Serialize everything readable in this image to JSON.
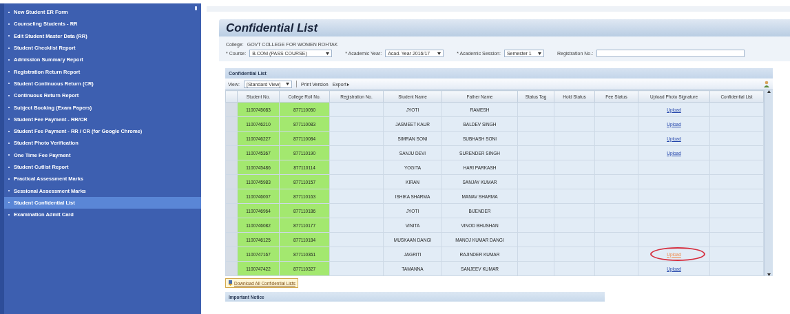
{
  "sidebar": {
    "items": [
      {
        "label": "New Student ER Form",
        "selected": false
      },
      {
        "label": "Counseling Students - RR",
        "selected": false
      },
      {
        "label": "Edit Student Master Data (RR)",
        "selected": false
      },
      {
        "label": "Student Checklist Report",
        "selected": false
      },
      {
        "label": "Admission Summary Report",
        "selected": false
      },
      {
        "label": "Registration Return Report",
        "selected": false
      },
      {
        "label": "Student Continuous Return (CR)",
        "selected": false
      },
      {
        "label": "Continuous Return Report",
        "selected": false
      },
      {
        "label": "Subject Booking (Exam Papers)",
        "selected": false
      },
      {
        "label": "Student Fee Payment - RR/CR",
        "selected": false
      },
      {
        "label": "Student Fee Payment - RR / CR (for Google Chrome)",
        "selected": false
      },
      {
        "label": "Student Photo Verification",
        "selected": false
      },
      {
        "label": "One Time Fee Payment",
        "selected": false
      },
      {
        "label": "Student Cutlist Report",
        "selected": false
      },
      {
        "label": "Practical Assessment Marks",
        "selected": false
      },
      {
        "label": "Sessional Assessment Marks",
        "selected": false
      },
      {
        "label": "Student Confidential List",
        "selected": true
      },
      {
        "label": "Examination Admit Card",
        "selected": false
      }
    ]
  },
  "page": {
    "title": "Confidential List",
    "filters": {
      "college_label": "College:",
      "college": "GOVT COLLEGE FOR WOMEN ROHTAK",
      "fields": [
        {
          "label": "* Course:",
          "value": "B.COM (PASS COURSE)",
          "kind": "dropdown"
        },
        {
          "label": "* Academic Year:",
          "value": "Acad. Year 2016/17",
          "kind": "dropdown"
        },
        {
          "label": "* Academic Session:",
          "value": "Semester 1",
          "kind": "dropdown"
        },
        {
          "label": "Registration No.:",
          "kind": "text"
        }
      ]
    },
    "panel": {
      "title": "Confidential List",
      "view_label": "View:",
      "view": "[Standard View]",
      "print": "Print Version",
      "export": "Export",
      "columns": [
        "Student No.",
        "College Roll No.",
        "Registration No.",
        "Student Name",
        "Father Name",
        "Status Tag",
        "Hold Status",
        "Fee Status",
        "Upload Photo Signature",
        "Confidential List"
      ],
      "rows": [
        {
          "student_no": "1100745083",
          "roll_no": "877110050",
          "name": "JYOTI",
          "father": "RAMESH",
          "upload": "Upload",
          "highlighted": false
        },
        {
          "student_no": "1100746210",
          "roll_no": "877110083",
          "name": "JASMEET KAUR",
          "father": "BALDEV SINGH",
          "upload": "Upload",
          "highlighted": false
        },
        {
          "student_no": "1100746227",
          "roll_no": "877110084",
          "name": "SIMRAN SONI",
          "father": "SUBHASH SONI",
          "upload": "Upload",
          "highlighted": false
        },
        {
          "student_no": "1100745367",
          "roll_no": "877110190",
          "name": "SANJU DEVI",
          "father": "SURENDER SINGH",
          "upload": "Upload",
          "highlighted": false
        },
        {
          "student_no": "1100745486",
          "roll_no": "877110114",
          "name": "YOGITA",
          "father": "HARI PARKASH"
        },
        {
          "student_no": "1100745983",
          "roll_no": "877110157",
          "name": "KIRAN",
          "father": "SANJAY KUMAR"
        },
        {
          "student_no": "1100746007",
          "roll_no": "877110163",
          "name": "ISHIKA SHARMA",
          "father": "MANAV SHARMA"
        },
        {
          "student_no": "1100746964",
          "roll_no": "877110186",
          "name": "JYOTI",
          "father": "BIJENDER"
        },
        {
          "student_no": "1100746082",
          "roll_no": "877110177",
          "name": "VINITA",
          "father": "VINOD BHUSHAN"
        },
        {
          "student_no": "1100746125",
          "roll_no": "877110184",
          "name": "MUSKAAN DANGI",
          "father": "MANOJ KUMAR DANGI"
        },
        {
          "student_no": "1100747167",
          "roll_no": "877110361",
          "name": "JAGRITI",
          "father": "RAJINDER KUMAR",
          "upload": "Upload",
          "highlighted": true
        },
        {
          "student_no": "1100747422",
          "roll_no": "877110327",
          "name": "TAMANNA",
          "father": "SANJEEV KUMAR",
          "upload": "Upload",
          "highlighted": false
        }
      ],
      "download": "Download All Confidential Lists"
    },
    "notice": {
      "title": "Important Notice"
    }
  }
}
